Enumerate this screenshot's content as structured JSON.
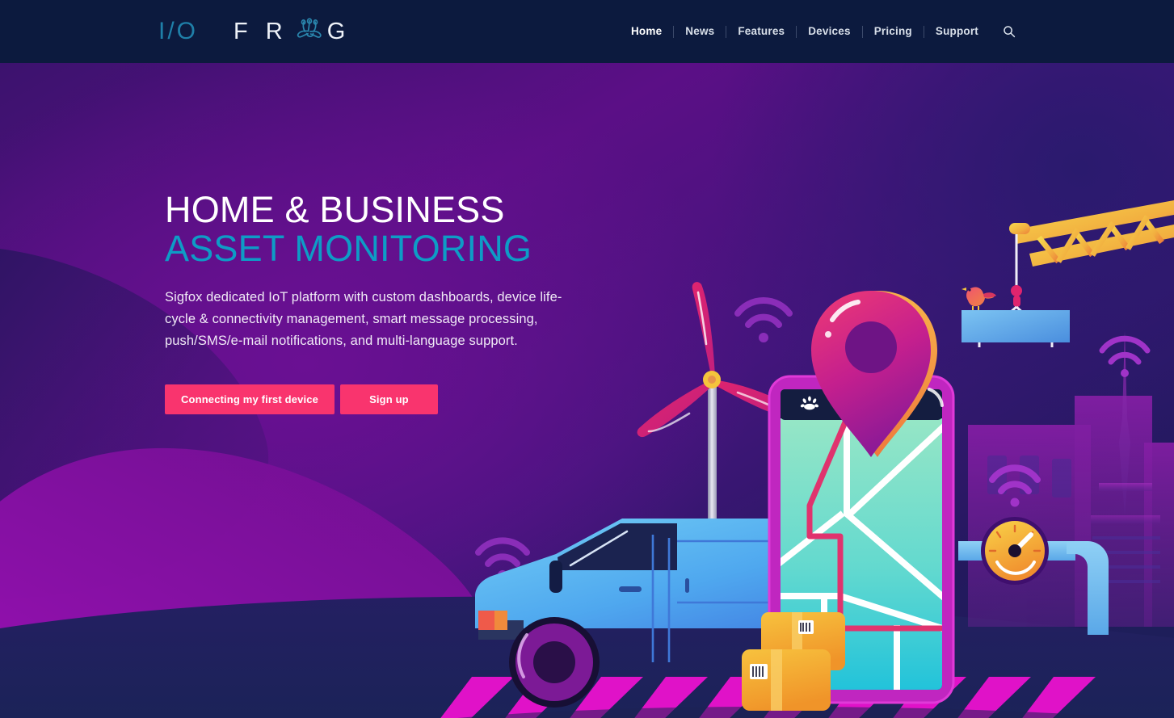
{
  "header": {
    "logo": {
      "prefix": "I/O",
      "word_before": "F R",
      "word_after": "G",
      "mark": "frog-glyph",
      "full_text": "I/O FROG",
      "prefix_color": "#1f7fa8",
      "word_color": "#eef2f8"
    },
    "background_color": "#0c1a3e",
    "nav": {
      "items": [
        {
          "label": "Home",
          "active": true
        },
        {
          "label": "News",
          "active": false
        },
        {
          "label": "Features",
          "active": false
        },
        {
          "label": "Devices",
          "active": false
        },
        {
          "label": "Pricing",
          "active": false
        },
        {
          "label": "Support",
          "active": false
        }
      ],
      "search_icon": "search-icon"
    }
  },
  "hero": {
    "headline_line1": "HOME & BUSINESS",
    "headline_line2": "ASSET MONITORING",
    "headline_line1_color": "#ffffff",
    "headline_line2_color": "#0e9cc6",
    "subcopy": "Sigfox dedicated IoT platform with custom dashboards, device life-cycle & connectivity management, smart message processing, push/SMS/e-mail notifications, and multi-language support.",
    "buttons": [
      {
        "label": "Connecting my first device",
        "color": "#f9346e"
      },
      {
        "label": "Sign up",
        "color": "#f9346e"
      }
    ],
    "background": {
      "gradient_from": "#3c126e",
      "gradient_mid": "#5b0f86",
      "gradient_to": "#1b2158",
      "wave_color": "#8d0fa8",
      "ground_color": "#1e2254"
    },
    "illustration": {
      "alt": "IoT asset monitoring scene",
      "elements": [
        "wind-turbine",
        "delivery-van",
        "smartphone-map",
        "map-pin",
        "construction-crane",
        "bird",
        "cargo-packages",
        "pressure-gauge",
        "city-buildings",
        "radio-tower",
        "crosswalk",
        "wifi-signals"
      ],
      "colors": {
        "van_body": "#55b6ef",
        "van_wheel": "#6b1a86",
        "phone_bezel": "#c026c0",
        "map_screen_top": "#8fe3c8",
        "map_screen_bottom": "#2dc5d8",
        "map_route": "#e0336e",
        "pin_top": "#e8376e",
        "pin_bottom": "#8d1a96",
        "pin_edge": "#f5a23c",
        "crane": "#f5cf4e",
        "crane_shadow": "#ef8a3c",
        "panel": "#5fa9e8",
        "bird": "#ef5a73",
        "package": "#f5a92e",
        "gauge_face": "#f5c43c",
        "turbine_blade": "#d9246e",
        "turbine_hub": "#f5c43c",
        "crosswalk": "#e012c8",
        "wifi": "#a033c8",
        "building": "#8a1fa8"
      }
    }
  }
}
